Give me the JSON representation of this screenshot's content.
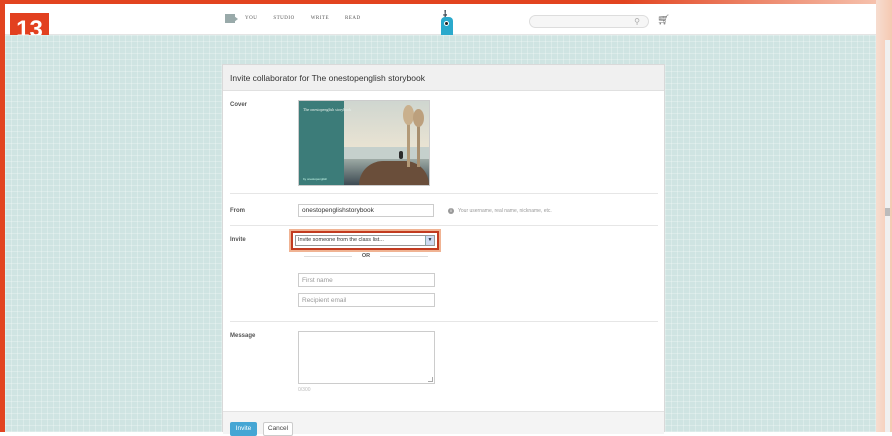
{
  "badge": "13",
  "nav": {
    "items": [
      "YOU",
      "STUDIO",
      "WRITE",
      "READ"
    ]
  },
  "search": {
    "placeholder": ""
  },
  "panel": {
    "title": "Invite collaborator for The onestopenglish storybook",
    "cover_label": "Cover",
    "cover": {
      "title": "The onestopenglish storybook",
      "author": "by onestopenglish"
    },
    "from_label": "From",
    "from_value": "onestopenglishstorybook",
    "from_hint": "Your username, real name, nickname, etc.",
    "invite_label": "Invite",
    "invite_select": "Invite someone from the class list...",
    "or_text": "OR",
    "first_name_placeholder": "First name",
    "email_placeholder": "Recipient email",
    "message_label": "Message",
    "char_count": "0/300",
    "invite_button": "Invite",
    "cancel_button": "Cancel"
  },
  "colors": {
    "accent": "#e2401f",
    "primary_button": "#45a6d4",
    "background": "#cfe4e2"
  }
}
